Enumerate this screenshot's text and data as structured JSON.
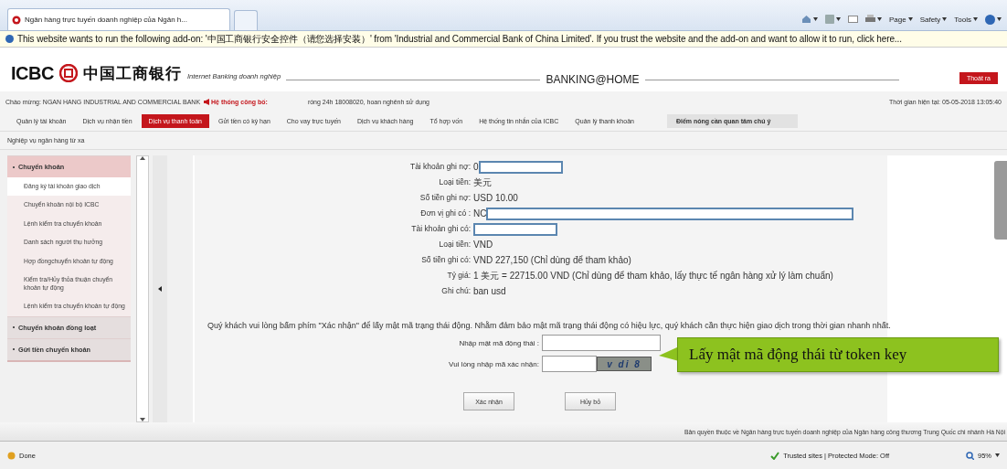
{
  "browser": {
    "tab_title": "Ngân hàng trực tuyến doanh nghiệp của Ngân h...",
    "toolbar": [
      {
        "label": "Page"
      },
      {
        "label": "Safety"
      },
      {
        "label": "Tools"
      }
    ],
    "info_bar": "This website wants to run the following add-on: '中国工商银行安全控件（请您选择安装）' from 'Industrial and Commercial Bank of China Limited'. If you trust the website and the add-on and want to allow it to run, click here..."
  },
  "header": {
    "logo_latin": "ICBC",
    "logo_chinese": "中国工商银行",
    "tagline": "Internet Banking doanh nghiệp",
    "brand": "BANKING@HOME",
    "logout": "Thoát ra"
  },
  "welcome": {
    "greeting": "Chào mừng: NGAN HANG INDUSTRIAL AND COMMERCIAL BANK",
    "notice_label": "Hệ thống công bố:",
    "notice": "róng 24h 18008020, hoan nghênh sử dụng",
    "time": "Thời gian hiện tại: 05-05-2018 13:05:40"
  },
  "nav": [
    {
      "label": "Quản lý tài khoản",
      "selected": false
    },
    {
      "label": "Dịch vụ nhận tiền",
      "selected": false
    },
    {
      "label": "Dịch vụ thanh toán",
      "selected": true
    },
    {
      "label": "Gửi tiền có kỳ hạn",
      "selected": false
    },
    {
      "label": "Cho vay trực tuyến",
      "selected": false
    },
    {
      "label": "Dịch vụ khách hàng",
      "selected": false
    },
    {
      "label": "Tổ hợp vốn",
      "selected": false
    },
    {
      "label": "Hệ thống tin nhắn của ICBC",
      "selected": false
    },
    {
      "label": "Quản lý thanh khoản",
      "selected": false
    },
    {
      "label": "Điểm nóng cần quan tâm chú ý",
      "selected": false,
      "kind": "highlight"
    }
  ],
  "subnav": "Nghiệp vụ ngân hàng từ xa",
  "sidebar": [
    {
      "label": "Chuyển khoản",
      "expanded": true,
      "children": [
        {
          "label": "Đăng ký tài khoản giao dịch",
          "selected": true
        },
        {
          "label": "Chuyển khoản nội bộ ICBC",
          "selected": false
        },
        {
          "label": "Lệnh kiểm tra chuyển khoản",
          "selected": false
        },
        {
          "label": "Danh sách người thụ hưởng",
          "selected": false
        },
        {
          "label": "Hợp đồngchuyển khoản tự động",
          "selected": false
        },
        {
          "label": "Kiểm tra/Hủy thỏa thuận chuyển khoản tự động",
          "selected": false
        },
        {
          "label": "Lệnh kiểm tra chuyển khoản tự động",
          "selected": false
        }
      ]
    },
    {
      "label": "Chuyển khoản đồng loạt",
      "expanded": false
    },
    {
      "label": "Gửi tiền chuyển khoản",
      "expanded": false
    }
  ],
  "form": {
    "rows": [
      {
        "label": "Tài khoản ghi nợ:",
        "value": "0",
        "kind": "masked"
      },
      {
        "label": "Loại tiền:",
        "value": "美元"
      },
      {
        "label": "Số tiền ghi nợ:",
        "value": "USD  10.00"
      },
      {
        "label": "Đơn vị ghi có :",
        "value": "NC",
        "kind": "masked-wide"
      },
      {
        "label": "Tài khoản ghi có:",
        "kind": "masked"
      },
      {
        "label": "Loại tiền:",
        "value": "VND"
      },
      {
        "label": "Số tiền ghi có:",
        "value": "VND  227,150 (Chỉ dùng để tham khảo)"
      },
      {
        "label": "Tỷ giá:",
        "value": "1 美元  = 22715.00 VND  (Chỉ dùng để tham khảo, lấy thực tế ngân hàng xử lý làm chuẩn)"
      },
      {
        "label": "Ghi chú:",
        "value": "ban usd"
      }
    ],
    "instruction": "Quý khách vui lòng bấm phím \"Xác nhận\" để lấy mật mã trạng thái động. Nhằm đảm bảo mật mã trạng thái động có hiệu lực, quý khách cần thực hiện giao dịch trong thời gian nhanh nhất.",
    "otp_label": "Nhập mật mã động thái :",
    "captcha_label": "Vui lòng nhập mã xác nhận:",
    "captcha": "v di 8",
    "buttons": [
      "Xác nhận",
      "Hủy bỏ"
    ]
  },
  "callout": "Lấy mật mã động thái từ token key",
  "footer": "Bản quyền thuộc về Ngân hàng trực tuyến doanh nghiệp của Ngân hàng công thương Trung Quốc chi nhánh Hà Nội",
  "status_bar": {
    "status": "Done",
    "zone": "Trusted sites | Protected Mode: Off",
    "zoom": "95%"
  }
}
